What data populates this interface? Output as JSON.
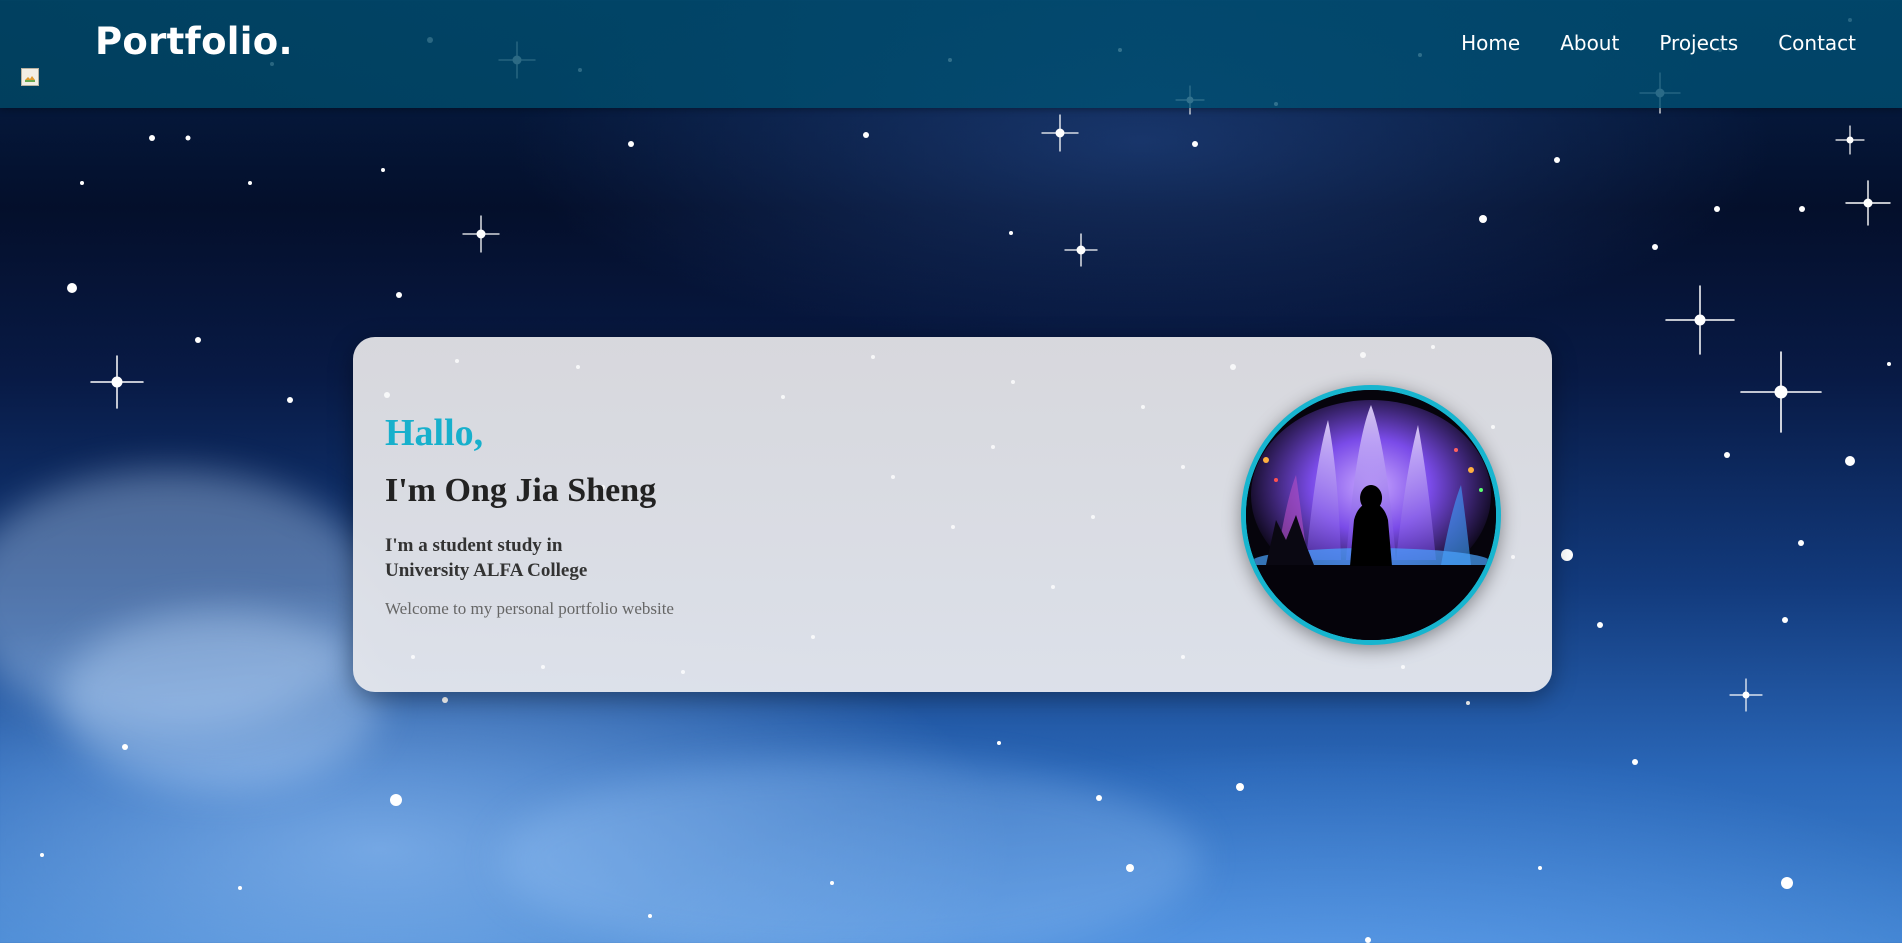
{
  "header": {
    "brand": "Portfolio.",
    "nav": [
      {
        "label": "Home"
      },
      {
        "label": "About"
      },
      {
        "label": "Projects"
      },
      {
        "label": "Contact"
      }
    ]
  },
  "hero": {
    "greeting": "Hallo,",
    "name": "I'm Ong Jia Sheng",
    "study_line1": "I'm a student study in",
    "study_line2": "University ALFA College",
    "welcome": "Welcome to my personal portfolio website"
  },
  "colors": {
    "accent": "#17b0cc",
    "header_bg": "#004a6e",
    "card_bg": "#dedee2"
  }
}
